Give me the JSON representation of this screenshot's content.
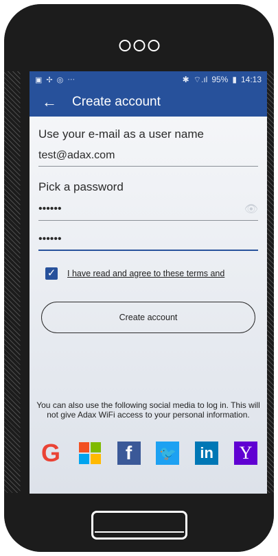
{
  "status_bar": {
    "left_icons": [
      "image-icon",
      "settings-icon",
      "instagram-icon",
      "more-icon"
    ],
    "more": "···",
    "bluetooth": "✱",
    "signal": "⌔.ıl",
    "battery": "95%",
    "time": "14:13"
  },
  "app_bar": {
    "back": "←",
    "title": "Create account"
  },
  "form": {
    "email_label": "Use your e-mail as a user name",
    "email_value": "test@adax.com",
    "password_label": "Pick a password",
    "password_value": "••••••",
    "password_confirm_value": "••••••",
    "terms_text": "I have read and agree to these terms and",
    "terms_checked": true,
    "submit_label": "Create account"
  },
  "social": {
    "note": "You can also use the following social media to log in. This will not give Adax WiFi access to your personal information.",
    "providers": [
      {
        "name": "google",
        "glyph": "G",
        "color": "#ea4335"
      },
      {
        "name": "microsoft",
        "glyph": "",
        "color": "#f25022"
      },
      {
        "name": "facebook",
        "glyph": "f",
        "color": "#3b5998"
      },
      {
        "name": "twitter",
        "glyph": "🐦",
        "color": "#1da1f2"
      },
      {
        "name": "linkedin",
        "glyph": "in",
        "color": "#0077b5"
      },
      {
        "name": "yahoo",
        "glyph": "Y",
        "color": "#6001d2"
      }
    ]
  },
  "colors": {
    "brand_blue": "#27519b"
  }
}
